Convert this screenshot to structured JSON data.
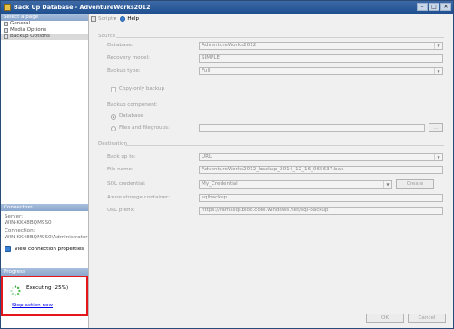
{
  "window": {
    "title": "Back Up Database - AdventureWorks2012",
    "controls": [
      "–",
      "□",
      "✕"
    ]
  },
  "left": {
    "select_page_header": "Select a page",
    "pages": [
      {
        "label": "General"
      },
      {
        "label": "Media Options"
      },
      {
        "label": "Backup Options"
      }
    ],
    "connection_header": "Connection",
    "server_label": "Server:",
    "server_value": "WIN-KK48BQM9S0",
    "connection_label": "Connection:",
    "connection_value": "WIN-KK48BQM9S0\\Administrator",
    "view_connection": "View connection properties",
    "progress_header": "Progress",
    "progress_status": "Executing (25%)",
    "progress_fraction": 0.25,
    "stop_action": "Stop action now"
  },
  "toolbar": {
    "script_label": "Script",
    "help_label": "Help"
  },
  "source": {
    "group_title": "Source",
    "database_label": "Database:",
    "database_value": "AdventureWorks2012",
    "recovery_label": "Recovery model:",
    "recovery_value": "SIMPLE",
    "backup_type_label": "Backup type:",
    "backup_type_value": "Full",
    "copy_only_label": "Copy-only backup",
    "component_label": "Backup component:",
    "component_database": "Database",
    "component_files": "Files and filegroups:",
    "browse_label": "..."
  },
  "destination": {
    "group_title": "Destination",
    "backup_to_label": "Back up to:",
    "backup_to_value": "URL",
    "file_name_label": "File name:",
    "file_name_value": "AdventureWorks2012_backup_2014_12_16_065637.bak",
    "credential_label": "SQL credential:",
    "credential_value": "My_Credential",
    "create_label": "Create",
    "container_label": "Azure storage container:",
    "container_value": "sqlbackup",
    "url_prefix_label": "URL prefix:",
    "url_prefix_value": "https://ramasql.blob.core.windows.net/sql-backup"
  },
  "footer": {
    "ok_label": "OK",
    "cancel_label": "Cancel"
  },
  "colors": {
    "title_bar": "#1f4f8f",
    "highlight_box": "#e3161c",
    "link": "#0000ee"
  }
}
